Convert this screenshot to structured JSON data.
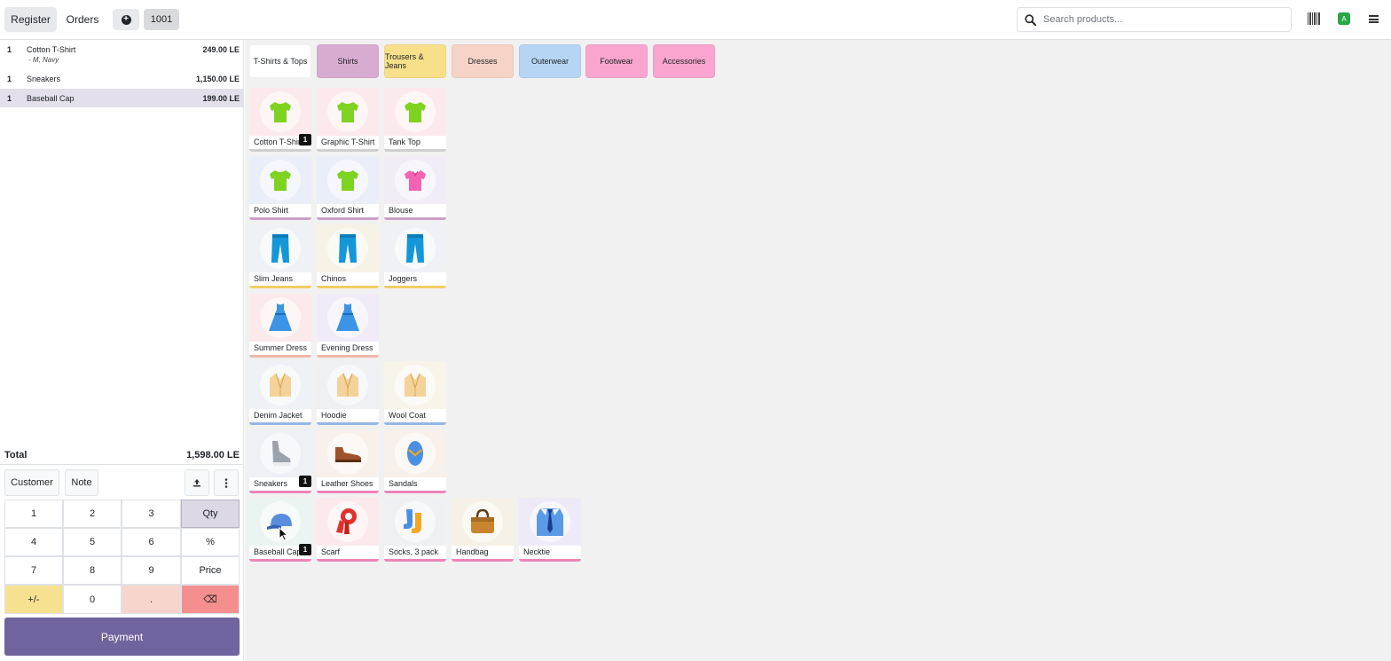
{
  "header": {
    "register_label": "Register",
    "orders_label": "Orders",
    "order_number": "1001",
    "search_placeholder": "Search products...",
    "status_letter": "A"
  },
  "order": {
    "lines": [
      {
        "qty": "1",
        "name": "Cotton T-Shirt",
        "note": "- M, Navy",
        "price": "249.00 LE"
      },
      {
        "qty": "1",
        "name": "Sneakers",
        "note": "",
        "price": "1,150.00 LE"
      },
      {
        "qty": "1",
        "name": "Baseball Cap",
        "note": "",
        "price": "199.00 LE"
      }
    ],
    "total_label": "Total",
    "total_value": "1,598.00 LE"
  },
  "actions": {
    "customer": "Customer",
    "note": "Note"
  },
  "numpad": {
    "keys": [
      "1",
      "2",
      "3",
      "Qty",
      "4",
      "5",
      "6",
      "%",
      "7",
      "8",
      "9",
      "Price",
      "+/-",
      "0",
      ".",
      "⌫"
    ]
  },
  "payment_label": "Payment",
  "categories": [
    {
      "label": "T-Shirts & Tops",
      "color": "#ffffff"
    },
    {
      "label": "Shirts",
      "color": "#d8acd1"
    },
    {
      "label": "Trousers & Jeans",
      "color": "#f8e08a"
    },
    {
      "label": "Dresses",
      "color": "#f6d3c6"
    },
    {
      "label": "Outerwear",
      "color": "#b6d5f4"
    },
    {
      "label": "Footwear",
      "color": "#f9a5cf"
    },
    {
      "label": "Accessories",
      "color": "#f9a5cf"
    }
  ],
  "products": [
    {
      "name": "Cotton T-Shirt",
      "icon": "tshirt-icon",
      "badge": "1"
    },
    {
      "name": "Graphic T-Shirt",
      "icon": "tshirt-icon",
      "badge": ""
    },
    {
      "name": "Tank Top",
      "icon": "tshirt-icon",
      "badge": ""
    },
    {
      "name": "Polo Shirt",
      "icon": "tshirt-icon",
      "badge": ""
    },
    {
      "name": "Oxford Shirt",
      "icon": "tshirt-icon",
      "badge": ""
    },
    {
      "name": "Blouse",
      "icon": "blouse-icon",
      "badge": ""
    },
    {
      "name": "Slim Jeans",
      "icon": "jeans-icon",
      "badge": ""
    },
    {
      "name": "Chinos",
      "icon": "jeans-icon",
      "badge": ""
    },
    {
      "name": "Joggers",
      "icon": "jeans-icon",
      "badge": ""
    },
    {
      "name": "Summer Dress",
      "icon": "dress-icon",
      "badge": ""
    },
    {
      "name": "Evening Dress",
      "icon": "dress-icon",
      "badge": ""
    },
    {
      "name": "Denim Jacket",
      "icon": "coat-icon",
      "badge": ""
    },
    {
      "name": "Hoodie",
      "icon": "coat-icon",
      "badge": ""
    },
    {
      "name": "Wool Coat",
      "icon": "coat-icon",
      "badge": ""
    },
    {
      "name": "Sneakers",
      "icon": "sneaker-icon",
      "badge": "1"
    },
    {
      "name": "Leather Shoes",
      "icon": "shoe-icon",
      "badge": ""
    },
    {
      "name": "Sandals",
      "icon": "sandal-icon",
      "badge": ""
    },
    {
      "name": "Baseball Cap",
      "icon": "cap-icon",
      "badge": "1"
    },
    {
      "name": "Scarf",
      "icon": "scarf-icon",
      "badge": ""
    },
    {
      "name": "Socks, 3 pack",
      "icon": "socks-icon",
      "badge": ""
    },
    {
      "name": "Handbag",
      "icon": "handbag-icon",
      "badge": ""
    },
    {
      "name": "Necktie",
      "icon": "necktie-icon",
      "badge": ""
    }
  ]
}
